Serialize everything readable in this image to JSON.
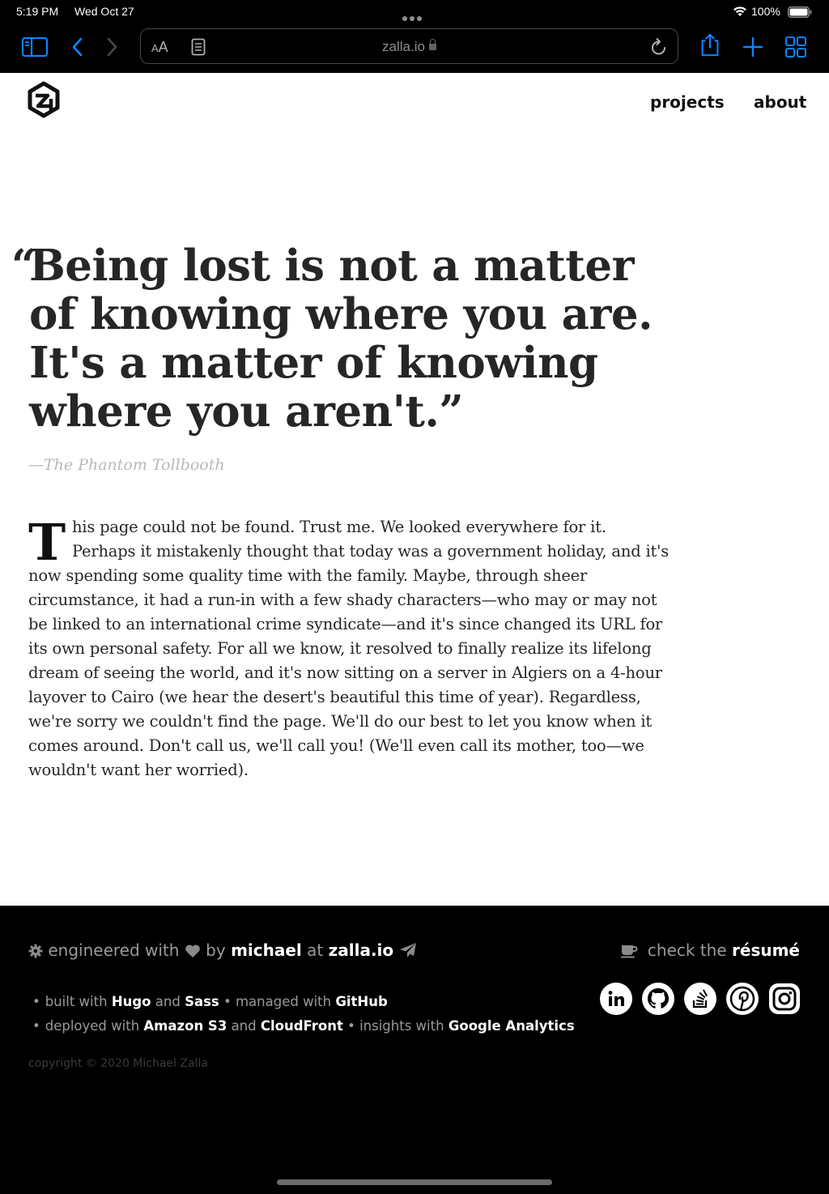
{
  "status_bar": {
    "time": "5:19 PM",
    "date": "Wed Oct 27",
    "battery": "100%"
  },
  "browser": {
    "text_size_small": "A",
    "text_size_large": "A",
    "url": "zalla.io",
    "icons": [
      "sidebar-icon",
      "back-icon",
      "forward-icon",
      "reader-icon",
      "lock-icon",
      "reload-icon",
      "share-icon",
      "new-tab-icon",
      "tabs-icon"
    ],
    "accent_color": "#0a84ff"
  },
  "header": {
    "logo": "zalla-logo",
    "nav": [
      {
        "label": "projects"
      },
      {
        "label": "about"
      }
    ]
  },
  "main": {
    "quote_open": "“",
    "quote": "Being lost is not a matter of knowing where you are. It's a matter of knowing where you aren't.”",
    "attribution": "—The Phantom Tollbooth",
    "dropcap": "T",
    "body": "his page could not be found. Trust me. We looked everywhere for it. Perhaps it mistakenly thought that today was a government holiday, and it's now spending some quality time with the family. Maybe, through sheer circumstance, it had a run-in with a few shady characters—who may or may not be linked to an international crime syndicate—and it's since changed its URL for its own personal safety. For all we know, it resolved to finally realize its lifelong dream of seeing the world, and it's now sitting on a server in Algiers on a 4-hour layover to Cairo (we hear the desert's beautiful this time of year). Regardless, we're sorry we couldn't find the page. We'll do our best to let you know when it comes around. Don't call us, we'll call you! (We'll even call its mother, too—we wouldn't want her worried)."
  },
  "footer": {
    "credit": {
      "engineered_with": "engineered with",
      "by": "by",
      "author": "michael",
      "at": "at",
      "site": "zalla.io"
    },
    "resume": {
      "prefix": "check the",
      "link": "résumé"
    },
    "tools": {
      "built_with": "built with",
      "hugo": "Hugo",
      "and1": "and",
      "sass": "Sass",
      "managed_with": "managed with",
      "github": "GitHub",
      "deployed_with": "deployed with",
      "s3": "Amazon S3",
      "and2": "and",
      "cloudfront": "CloudFront",
      "insights_with": "insights with",
      "analytics": "Google Analytics",
      "bullet": "•"
    },
    "social": [
      "linkedin-icon",
      "github-icon",
      "stackoverflow-icon",
      "pinterest-icon",
      "instagram-icon"
    ],
    "copyright": "copyright © 2020 Michael Zalla"
  }
}
